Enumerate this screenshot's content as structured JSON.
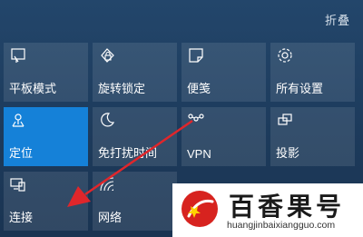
{
  "header": {
    "collapse_label": "折叠"
  },
  "tiles": [
    {
      "label": "平板模式",
      "icon": "tablet-mode-icon",
      "active": false
    },
    {
      "label": "旋转锁定",
      "icon": "rotation-lock-icon",
      "active": false
    },
    {
      "label": "便笺",
      "icon": "note-icon",
      "active": false
    },
    {
      "label": "所有设置",
      "icon": "gear-icon",
      "active": false
    },
    {
      "label": "定位",
      "icon": "location-icon",
      "active": true
    },
    {
      "label": "免打扰时间",
      "icon": "moon-icon",
      "active": false
    },
    {
      "label": "VPN",
      "icon": "vpn-icon",
      "active": false
    },
    {
      "label": "投影",
      "icon": "project-icon",
      "active": false
    },
    {
      "label": "连接",
      "icon": "connect-icon",
      "active": false
    },
    {
      "label": "网络",
      "icon": "network-icon",
      "active": false
    }
  ],
  "watermark": {
    "title": "百香果号",
    "subtitle": "huangjinbaixiangguo.com"
  },
  "colors": {
    "background": "#1d3b5c",
    "tile": "#3a5775",
    "active_tile": "#1581d8",
    "arrow": "#e0262b"
  }
}
